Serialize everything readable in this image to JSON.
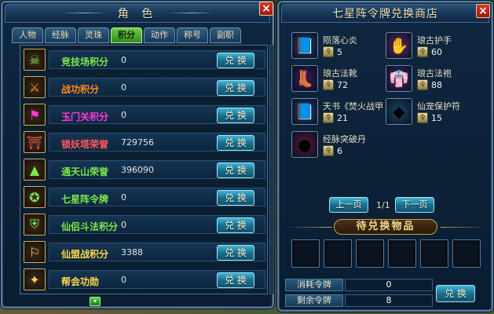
{
  "left_panel": {
    "title": "角 色",
    "close_label": "×",
    "tabs": [
      {
        "label": "人物",
        "active": false
      },
      {
        "label": "经脉",
        "active": false
      },
      {
        "label": "灵珠",
        "active": false
      },
      {
        "label": "积分",
        "active": true
      },
      {
        "label": "动作",
        "active": false
      },
      {
        "label": "称号",
        "active": false
      },
      {
        "label": "副职",
        "active": false
      }
    ],
    "rows": [
      {
        "label": "竞技场积分",
        "value": "0",
        "color": "#7ee84a",
        "icon": "demon-mask-icon",
        "glyph": "☠",
        "button": "兑 换"
      },
      {
        "label": "战功积分",
        "value": "0",
        "color": "#ff8c1a",
        "icon": "helmet-badge-icon",
        "glyph": "⚔",
        "button": "兑 换"
      },
      {
        "label": "玉门关积分",
        "value": "0",
        "color": "#ff3ad8",
        "icon": "fortress-flag-icon",
        "glyph": "⚑",
        "button": "兑 换"
      },
      {
        "label": "锁妖塔荣誉",
        "value": "729756",
        "color": "#ff5a5a",
        "icon": "pagoda-icon",
        "glyph": "⛩",
        "button": "兑 换"
      },
      {
        "label": "通天山荣誉",
        "value": "396090",
        "color": "#7ee84a",
        "icon": "mountain-crystal-icon",
        "glyph": "▲",
        "button": "兑 换"
      },
      {
        "label": "七星阵令牌",
        "value": "0",
        "color": "#7ee84a",
        "icon": "seven-star-token-icon",
        "glyph": "✪",
        "button": "兑 换"
      },
      {
        "label": "仙侣斗法积分",
        "value": "0",
        "color": "#7ee84a",
        "icon": "shield-emblem-icon",
        "glyph": "⛨",
        "button": "兑 换"
      },
      {
        "label": "仙盟战积分",
        "value": "3388",
        "color": "#ffd84a",
        "icon": "war-banner-icon",
        "glyph": "⚐",
        "button": "兑 换"
      },
      {
        "label": "帮会功勋",
        "value": "0",
        "color": "#ffd84a",
        "icon": "guild-seal-icon",
        "glyph": "✦",
        "button": "兑 换"
      }
    ],
    "bottom_knob": "▾"
  },
  "right_panel": {
    "title": "七星阵令牌兑换商店",
    "close_label": "×",
    "items": [
      {
        "name": "陨落心炎",
        "cost": "5",
        "icon": "book-icon",
        "glyph": "📘",
        "bg": "#2a3a6a"
      },
      {
        "name": "琅古护手",
        "cost": "60",
        "icon": "gauntlet-icon",
        "glyph": "✋",
        "bg": "#5a2a6a"
      },
      {
        "name": "琅古法靴",
        "cost": "72",
        "icon": "boots-icon",
        "glyph": "👢",
        "bg": "#3a1a5a"
      },
      {
        "name": "琅古法袍",
        "cost": "88",
        "icon": "robe-icon",
        "glyph": "👘",
        "bg": "#3a2a6a"
      },
      {
        "name": "天书《焚火战甲",
        "cost": "21",
        "icon": "skill-book-icon",
        "glyph": "📘",
        "bg": "#2a3a6a"
      },
      {
        "name": "仙宠保护符",
        "cost": "15",
        "icon": "pet-charm-icon",
        "glyph": "◆",
        "bg": "#1a4a6a"
      },
      {
        "name": "经脉突破丹",
        "cost": "6",
        "icon": "pill-icon",
        "glyph": "●",
        "bg": "#5a1a3a"
      }
    ],
    "cost_icon_glyph": "令",
    "prev_page": "上一页",
    "next_page": "下一页",
    "page_indicator": "1/1",
    "pending_banner": "待兑换物品",
    "slot_count": 6,
    "consume_label": "消耗令牌",
    "consume_value": "0",
    "remaining_label": "剩余令牌",
    "remaining_value": "8",
    "exchange_button": "兑 换"
  }
}
